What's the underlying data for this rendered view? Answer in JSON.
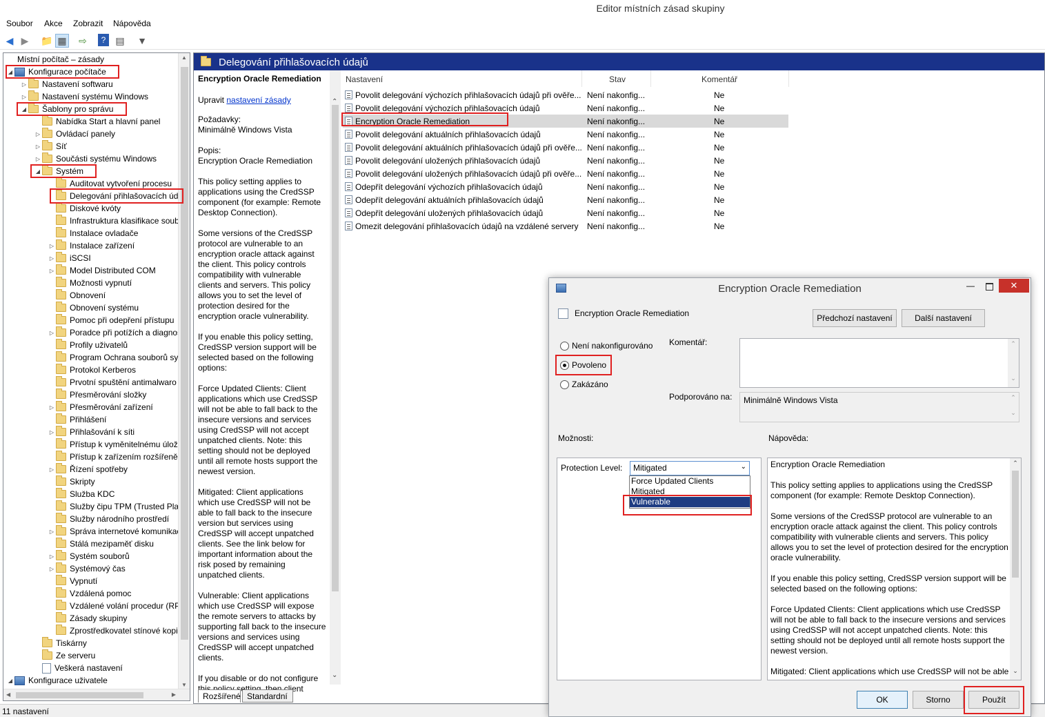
{
  "window": {
    "title": "Editor místních zásad skupiny"
  },
  "menu": [
    "Soubor",
    "Akce",
    "Zobrazit",
    "Nápověda"
  ],
  "tree": {
    "root": "Místní počítač – zásady",
    "nodes": [
      {
        "label": "Konfigurace počítače",
        "level": 0,
        "arrow": "◢"
      },
      {
        "label": "Nastavení softwaru",
        "level": 1,
        "arrow": "▷"
      },
      {
        "label": "Nastavení systému Windows",
        "level": 1,
        "arrow": "▷"
      },
      {
        "label": "Šablony pro správu",
        "level": 1,
        "arrow": "◢"
      },
      {
        "label": "Nabídka Start a hlavní panel",
        "level": 2,
        "arrow": ""
      },
      {
        "label": "Ovládací panely",
        "level": 2,
        "arrow": "▷"
      },
      {
        "label": "Síť",
        "level": 2,
        "arrow": "▷"
      },
      {
        "label": "Součásti systému Windows",
        "level": 2,
        "arrow": "▷"
      },
      {
        "label": "Systém",
        "level": 2,
        "arrow": "◢"
      },
      {
        "label": "Auditovat vytvoření procesu",
        "level": 3,
        "arrow": ""
      },
      {
        "label": "Delegování přihlašovacích úd",
        "level": 3,
        "arrow": ""
      },
      {
        "label": "Diskové kvóty",
        "level": 3,
        "arrow": ""
      },
      {
        "label": "Infrastruktura klasifikace soub",
        "level": 3,
        "arrow": ""
      },
      {
        "label": "Instalace ovladače",
        "level": 3,
        "arrow": ""
      },
      {
        "label": "Instalace zařízení",
        "level": 3,
        "arrow": "▷"
      },
      {
        "label": "iSCSI",
        "level": 3,
        "arrow": "▷"
      },
      {
        "label": "Model Distributed COM",
        "level": 3,
        "arrow": "▷"
      },
      {
        "label": "Možnosti vypnutí",
        "level": 3,
        "arrow": ""
      },
      {
        "label": "Obnovení",
        "level": 3,
        "arrow": ""
      },
      {
        "label": "Obnovení systému",
        "level": 3,
        "arrow": ""
      },
      {
        "label": "Pomoc při odepření přístupu",
        "level": 3,
        "arrow": ""
      },
      {
        "label": "Poradce při potížích a diagnos",
        "level": 3,
        "arrow": "▷"
      },
      {
        "label": "Profily uživatelů",
        "level": 3,
        "arrow": ""
      },
      {
        "label": "Program Ochrana souborů sy",
        "level": 3,
        "arrow": ""
      },
      {
        "label": "Protokol Kerberos",
        "level": 3,
        "arrow": ""
      },
      {
        "label": "Prvotní spuštění antimalwaro",
        "level": 3,
        "arrow": ""
      },
      {
        "label": "Přesměrování složky",
        "level": 3,
        "arrow": ""
      },
      {
        "label": "Přesměrování zařízení",
        "level": 3,
        "arrow": "▷"
      },
      {
        "label": "Přihlášení",
        "level": 3,
        "arrow": ""
      },
      {
        "label": "Přihlašování k síti",
        "level": 3,
        "arrow": "▷"
      },
      {
        "label": "Přístup k vyměnitelnému úlož",
        "level": 3,
        "arrow": ""
      },
      {
        "label": "Přístup k zařízením rozšířeně",
        "level": 3,
        "arrow": ""
      },
      {
        "label": "Řízení spotřeby",
        "level": 3,
        "arrow": "▷"
      },
      {
        "label": "Skripty",
        "level": 3,
        "arrow": ""
      },
      {
        "label": "Služba KDC",
        "level": 3,
        "arrow": ""
      },
      {
        "label": "Služby čipu TPM (Trusted Plat",
        "level": 3,
        "arrow": ""
      },
      {
        "label": "Služby národního prostředí",
        "level": 3,
        "arrow": ""
      },
      {
        "label": "Správa internetové komunikac",
        "level": 3,
        "arrow": "▷"
      },
      {
        "label": "Stálá mezipaměť disku",
        "level": 3,
        "arrow": ""
      },
      {
        "label": "Systém souborů",
        "level": 3,
        "arrow": "▷"
      },
      {
        "label": "Systémový čas",
        "level": 3,
        "arrow": "▷"
      },
      {
        "label": "Vypnutí",
        "level": 3,
        "arrow": ""
      },
      {
        "label": "Vzdálená pomoc",
        "level": 3,
        "arrow": ""
      },
      {
        "label": "Vzdálené volání procedur (RP",
        "level": 3,
        "arrow": ""
      },
      {
        "label": "Zásady skupiny",
        "level": 3,
        "arrow": ""
      },
      {
        "label": "Zprostředkovatel stínové kopi",
        "level": 3,
        "arrow": ""
      },
      {
        "label": "Tiskárny",
        "level": 2,
        "arrow": ""
      },
      {
        "label": "Ze serveru",
        "level": 2,
        "arrow": ""
      },
      {
        "label": "Veškerá nastavení",
        "level": 2,
        "arrow": ""
      },
      {
        "label": "Konfigurace uživatele",
        "level": 0,
        "arrow": "◢"
      }
    ]
  },
  "panel": {
    "header": "Delegování přihlašovacích údajů",
    "description": {
      "title": "Encryption Oracle Remediation",
      "edit_prefix": "Upravit",
      "edit_link": "nastavení zásady",
      "req_label": "Požadavky:",
      "req_value": "Minimálně Windows Vista",
      "desc_label": "Popis:",
      "desc_title": "Encryption Oracle Remediation",
      "paragraphs": [
        "This policy setting applies to applications using the CredSSP component (for example: Remote Desktop Connection).",
        "Some versions of the CredSSP protocol are vulnerable to an encryption oracle attack against the client.  This policy controls compatibility with vulnerable clients and servers.  This policy allows you to set the level of protection desired for the encryption oracle vulnerability.",
        "If you enable this policy setting, CredSSP version support will be selected based on the following options:",
        "Force Updated Clients: Client applications which use CredSSP will not be able to fall back to the insecure versions and services using CredSSP will not accept unpatched clients. Note: this setting should not be deployed until all remote hosts support the newest version.",
        "Mitigated: Client applications which use CredSSP will not be able to fall back to the insecure version but services using CredSSP will accept unpatched clients. See the link below for important information about the risk posed by remaining unpatched clients.",
        "Vulnerable: Client applications which use CredSSP will expose the remote servers to attacks by supporting fall back to the insecure versions and services using CredSSP will accept unpatched clients.",
        "If you disable or do not configure this policy setting, then client"
      ]
    },
    "tabs": [
      "Rozšířené",
      "Standardní"
    ],
    "columns": [
      "Nastavení",
      "Stav",
      "Komentář"
    ],
    "rows": [
      [
        "Povolit delegování výchozích přihlašovacích údajů při ověře...",
        "Není nakonfig...",
        "Ne"
      ],
      [
        "Povolit delegování výchozích přihlašovacích údajů",
        "Není nakonfig...",
        "Ne"
      ],
      [
        "Encryption Oracle Remediation",
        "Není nakonfig...",
        "Ne"
      ],
      [
        "Povolit delegování aktuálních přihlašovacích údajů",
        "Není nakonfig...",
        "Ne"
      ],
      [
        "Povolit delegování aktuálních přihlašovacích údajů při ověře...",
        "Není nakonfig...",
        "Ne"
      ],
      [
        "Povolit delegování uložených přihlašovacích údajů",
        "Není nakonfig...",
        "Ne"
      ],
      [
        "Povolit delegování uložených přihlašovacích údajů při ověře...",
        "Není nakonfig...",
        "Ne"
      ],
      [
        "Odepřít delegování výchozích přihlašovacích údajů",
        "Není nakonfig...",
        "Ne"
      ],
      [
        "Odepřít delegování aktuálních přihlašovacích údajů",
        "Není nakonfig...",
        "Ne"
      ],
      [
        "Odepřít delegování uložených přihlašovacích údajů",
        "Není nakonfig...",
        "Ne"
      ],
      [
        "Omezit delegování přihlašovacích údajů na vzdálené servery",
        "Není nakonfig...",
        "Ne"
      ]
    ]
  },
  "status": "11 nastavení",
  "dialog": {
    "title": "Encryption Oracle Remediation",
    "policy_name": "Encryption Oracle Remediation",
    "prev_button": "Předchozí nastavení",
    "next_button": "Další nastavení",
    "radios": [
      "Není nakonfigurováno",
      "Povoleno",
      "Zakázáno"
    ],
    "selected_radio": "Povoleno",
    "comment_label": "Komentář:",
    "supported_label": "Podporováno na:",
    "supported_value": "Minimálně Windows Vista",
    "options_label": "Možnosti:",
    "help_label": "Nápověda:",
    "protection_label": "Protection Level:",
    "protection_value": "Mitigated",
    "dropdown_options": [
      "Force Updated Clients",
      "Mitigated",
      "Vulnerable"
    ],
    "dropdown_highlight": "Vulnerable",
    "help_paragraphs": [
      "Encryption Oracle Remediation",
      "This policy setting applies to applications using the CredSSP component (for example: Remote Desktop Connection).",
      "Some versions of the CredSSP protocol are vulnerable to an encryption oracle attack against the client.  This policy controls compatibility with vulnerable clients and servers.  This policy allows you to set the level of protection desired for the encryption oracle vulnerability.",
      "If you enable this policy setting, CredSSP version support will be selected based on the following options:",
      "Force Updated Clients: Client applications which use CredSSP will not be able to fall back to the insecure versions and services using CredSSP will not accept unpatched clients. Note: this setting should not be deployed until all remote hosts support the newest version.",
      "Mitigated: Client applications which use CredSSP will not be able"
    ],
    "ok": "OK",
    "cancel": "Storno",
    "apply": "Použít"
  }
}
